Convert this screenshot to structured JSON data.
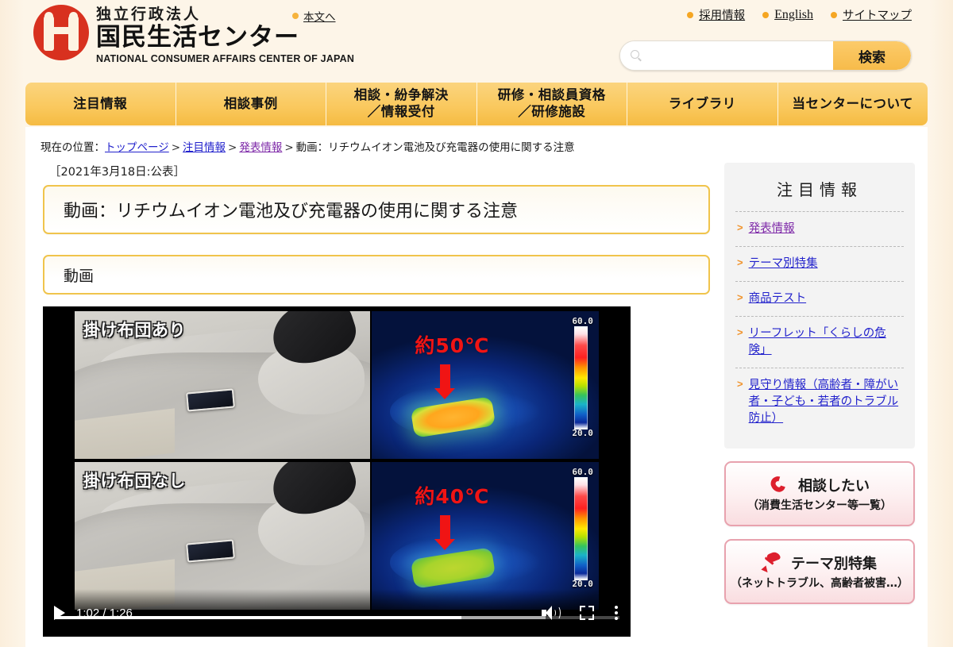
{
  "site": {
    "logo_sub": "独立行政法人",
    "logo_main": "国民生活センター",
    "logo_en": "NATIONAL CONSUMER AFFAIRS CENTER OF JAPAN",
    "skip_link": "本文へ"
  },
  "utility_nav": [
    {
      "label": "採用情報"
    },
    {
      "label": "English"
    },
    {
      "label": "サイトマップ"
    }
  ],
  "search": {
    "value": "",
    "placeholder": "",
    "button_label": "検索",
    "icon": "search-icon"
  },
  "global_nav": [
    {
      "line1": "注目情報",
      "line2": ""
    },
    {
      "line1": "相談事例",
      "line2": ""
    },
    {
      "line1": "相談・紛争解決",
      "line2": "／情報受付"
    },
    {
      "line1": "研修・相談員資格",
      "line2": "／研修施設"
    },
    {
      "line1": "ライブラリ",
      "line2": ""
    },
    {
      "line1": "当センターについて",
      "line2": ""
    }
  ],
  "breadcrumb": {
    "prefix": "現在の位置：",
    "items": [
      {
        "label": "トップページ",
        "link": true,
        "visited": false
      },
      {
        "label": "注目情報",
        "link": true,
        "visited": false
      },
      {
        "label": "発表情報",
        "link": true,
        "visited": true
      },
      {
        "label": "動画：リチウムイオン電池及び充電器の使用に関する注意",
        "link": false,
        "visited": false
      }
    ],
    "separator": ">"
  },
  "article": {
    "publish_date": "［2021年3月18日:公表］",
    "title": "動画：リチウムイオン電池及び充電器の使用に関する注意",
    "section_heading": "動画"
  },
  "video": {
    "current_time": "1:02",
    "duration": "1:26",
    "time_display": "1:02 / 1:26",
    "progress_percent": 72,
    "buffered_percent": 87,
    "panels": [
      {
        "id": "top-left",
        "type": "photo",
        "label": "掛け布団あり"
      },
      {
        "id": "top-right",
        "type": "thermal",
        "temp_label": "約50℃",
        "scale_max": "60.0",
        "scale_min": "20.0"
      },
      {
        "id": "bottom-left",
        "type": "photo",
        "label": "掛け布団なし"
      },
      {
        "id": "bottom-right",
        "type": "thermal",
        "temp_label": "約40℃",
        "scale_max": "60.0",
        "scale_min": "20.0"
      }
    ],
    "controls": [
      {
        "name": "play-button",
        "icon": "play-icon"
      },
      {
        "name": "volume-button",
        "icon": "volume-icon"
      },
      {
        "name": "fullscreen-button",
        "icon": "fullscreen-icon"
      },
      {
        "name": "more-options-button",
        "icon": "kebab-menu-icon"
      }
    ]
  },
  "sidebar": {
    "panel_title": "注目情報",
    "items": [
      {
        "label": "発表情報",
        "visited": true
      },
      {
        "label": "テーマ別特集",
        "visited": false
      },
      {
        "label": "商品テスト",
        "visited": false
      },
      {
        "label": "リーフレット「くらしの危険」",
        "visited": false
      },
      {
        "label": "見守り情報（高齢者・障がい者・子ども・若者のトラブル防止）",
        "visited": false
      }
    ],
    "buttons": [
      {
        "icon": "phone-icon",
        "main": "相談したい",
        "sub": "（消費生活センター等一覧）"
      },
      {
        "icon": "pin-icon",
        "main": "テーマ別特集",
        "sub": "（ネットトラブル、高齢者被害…）"
      }
    ]
  },
  "colors": {
    "page_bg": "#fdf3e2",
    "nav_gold": "#fac95f",
    "accent_orange": "#f5a623",
    "link_blue": "#2222cc",
    "link_visited": "#7e29a8",
    "logo_red": "#d8311f",
    "button_pink_border": "#e8a2ae",
    "thermal_red": "#f01414"
  }
}
